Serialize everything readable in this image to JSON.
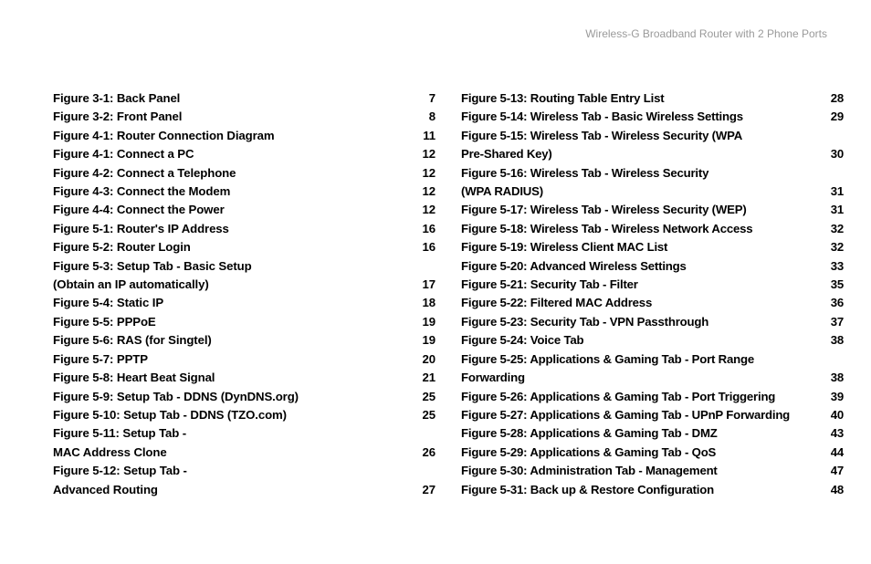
{
  "header": {
    "running_title": "Wireless-G Broadband Router with 2 Phone Ports"
  },
  "figures_col1": [
    {
      "label": "Figure 3-1: Back Panel",
      "page": "7"
    },
    {
      "label": "Figure 3-2: Front Panel",
      "page": "8"
    },
    {
      "label": "Figure 4-1: Router Connection Diagram",
      "page": "11"
    },
    {
      "label": "Figure 4-1: Connect a PC",
      "page": "12"
    },
    {
      "label": "Figure 4-2: Connect a Telephone",
      "page": "12"
    },
    {
      "label": "Figure 4-3: Connect the Modem",
      "page": "12"
    },
    {
      "label": "Figure 4-4: Connect the Power",
      "page": "12"
    },
    {
      "label": "Figure 5-1: Router's IP Address",
      "page": "16"
    },
    {
      "label": "Figure 5-2: Router Login",
      "page": "16"
    },
    {
      "label": "Figure 5-3: Setup Tab - Basic Setup",
      "cont": "(Obtain an IP automatically)",
      "page": "17"
    },
    {
      "label": "Figure 5-4: Static IP",
      "page": "18"
    },
    {
      "label": "Figure 5-5: PPPoE",
      "page": "19"
    },
    {
      "label": "Figure 5-6: RAS (for Singtel)",
      "page": "19"
    },
    {
      "label": "Figure 5-7: PPTP",
      "page": "20"
    },
    {
      "label": "Figure 5-8: Heart Beat Signal",
      "page": "21"
    },
    {
      "label": "Figure 5-9: Setup Tab - DDNS (DynDNS.org)",
      "page": "25"
    },
    {
      "label": "Figure 5-10: Setup Tab - DDNS (TZO.com)",
      "page": "25"
    },
    {
      "label": "Figure 5-11: Setup Tab -",
      "cont": "MAC Address Clone",
      "page": "26"
    },
    {
      "label": "Figure 5-12: Setup Tab -",
      "cont": "Advanced Routing",
      "page": "27"
    }
  ],
  "figures_col2": [
    {
      "label": "Figure 5-13: Routing Table Entry List",
      "page": "28"
    },
    {
      "label": "Figure 5-14: Wireless Tab - Basic Wireless Settings",
      "page": "29"
    },
    {
      "label": "Figure 5-15: Wireless Tab -  Wireless Security (WPA",
      "cont": "Pre-Shared Key)",
      "page": "30"
    },
    {
      "label": "Figure 5-16: Wireless Tab -  Wireless Security",
      "cont": "(WPA RADIUS)",
      "page": "31"
    },
    {
      "label": "Figure 5-17: Wireless Tab -  Wireless Security (WEP)",
      "page": "31"
    },
    {
      "label": "Figure 5-18: Wireless Tab -  Wireless Network Access",
      "page": "32"
    },
    {
      "label": "Figure 5-19: Wireless Client MAC List",
      "page": "32"
    },
    {
      "label": "Figure 5-20: Advanced Wireless Settings",
      "page": "33"
    },
    {
      "label": "Figure 5-21: Security Tab - Filter",
      "page": "35"
    },
    {
      "label": "Figure 5-22: Filtered MAC Address",
      "page": "36"
    },
    {
      "label": "Figure 5-23: Security Tab - VPN Passthrough",
      "page": "37"
    },
    {
      "label": "Figure 5-24: Voice Tab",
      "page": "38"
    },
    {
      "label": "Figure 5-25: Applications & Gaming Tab - Port Range",
      "cont": "Forwarding",
      "page": "38"
    },
    {
      "label": "Figure 5-26: Applications & Gaming Tab - Port Triggering",
      "page": "39"
    },
    {
      "label": "Figure 5-27: Applications & Gaming Tab - UPnP Forwarding",
      "page": "40"
    },
    {
      "label": "Figure 5-28: Applications & Gaming Tab - DMZ",
      "page": "43"
    },
    {
      "label": "Figure 5-29: Applications & Gaming Tab - QoS",
      "page": "44"
    },
    {
      "label": "Figure 5-30: Administration Tab - Management",
      "page": "47"
    },
    {
      "label": "Figure 5-31: Back up & Restore Configuration",
      "page": "48"
    }
  ]
}
